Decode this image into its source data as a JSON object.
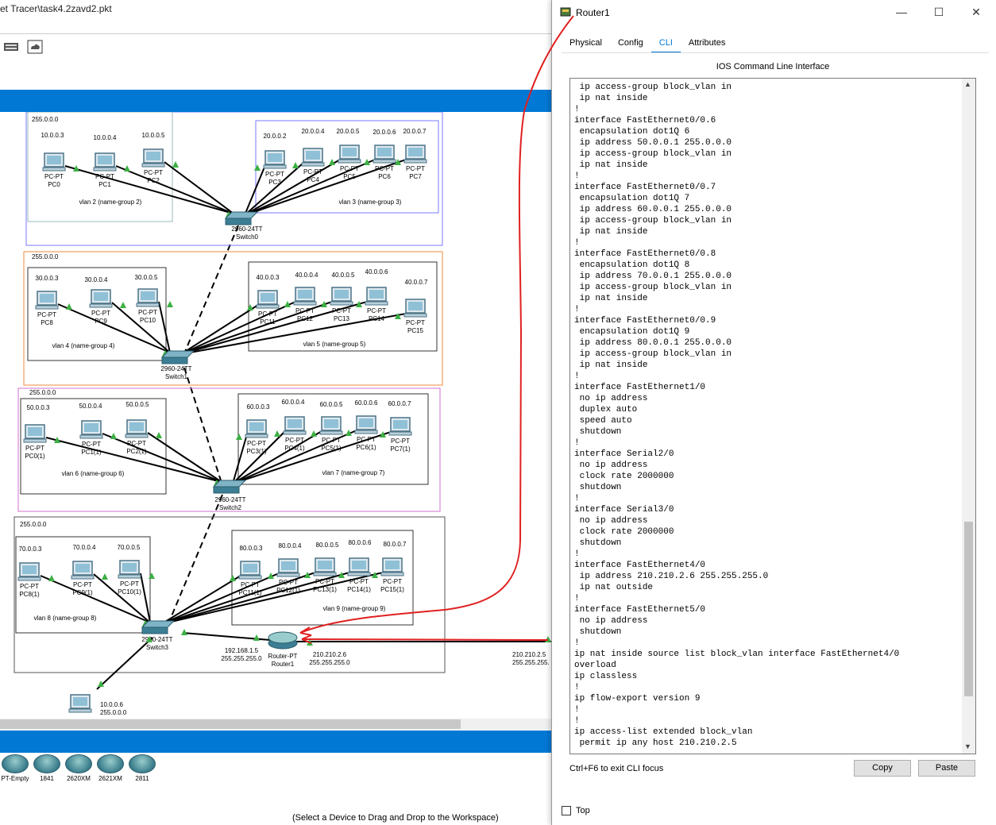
{
  "app": {
    "title": "et Tracer\\task4.2zavd2.pkt",
    "status_hint": "(Select a Device to Drag and Drop to the Workspace)"
  },
  "devices": [
    {
      "label": "PT-Empty",
      "icon": "router-icon"
    },
    {
      "label": "1841",
      "icon": "router-icon"
    },
    {
      "label": "2620XM",
      "icon": "router-icon"
    },
    {
      "label": "2621XM",
      "icon": "router-icon"
    },
    {
      "label": "2811",
      "icon": "router-icon"
    }
  ],
  "topology": {
    "group1": {
      "mask": "255.0.0.0",
      "left": {
        "label": "vlan 2 (name-group 2)",
        "pcs": [
          {
            "ip": "10.0.0.3",
            "name": "PC-PT\nPC0"
          },
          {
            "ip": "10.0.0.4",
            "name": "PC-PT\nPC1"
          },
          {
            "ip": "10.0.0.5",
            "name": "PC-PT\nPC2"
          }
        ]
      },
      "right": {
        "label": "vlan 3 (name-group 3)",
        "pcs": [
          {
            "ip": "20.0.0.2",
            "name": "PC-PT\nPC3"
          },
          {
            "ip": "20.0.0.4",
            "name": "PC-PT\nPC4"
          },
          {
            "ip": "20.0.0.5",
            "name": "PC-PT\nPC5"
          },
          {
            "ip": "20.0.0.6",
            "name": "PC-PT\nPC6"
          },
          {
            "ip": "20.0.0.7",
            "name": "PC-PT\nPC7"
          }
        ]
      },
      "switch": "2960-24TT\nSwitch0"
    },
    "group2": {
      "mask": "255.0.0.0",
      "left": {
        "label": "vlan 4 (name-group 4)",
        "pcs": [
          {
            "ip": "30.0.0.3",
            "name": "PC-PT\nPC8"
          },
          {
            "ip": "30.0.0.4",
            "name": "PC-PT\nPC9"
          },
          {
            "ip": "30.0.0.5",
            "name": "PC-PT\nPC10"
          }
        ]
      },
      "right": {
        "label": "vlan 5 (name-group 5)",
        "pcs": [
          {
            "ip": "40.0.0.3",
            "name": "PC-PT\nPC11"
          },
          {
            "ip": "40.0.0.4",
            "name": "PC-PT\nPC12"
          },
          {
            "ip": "40.0.0.5",
            "name": "PC-PT\nPC13"
          },
          {
            "ip": "40.0.0.6",
            "name": "PC-PT\nPC14"
          },
          {
            "ip": "40.0.0.7",
            "name": "PC-PT\nPC15"
          }
        ]
      },
      "switch": "2960-24TT\nSwitch1"
    },
    "group3": {
      "mask": "255.0.0.0",
      "left": {
        "label": "vlan 6 (name-group 6)",
        "pcs": [
          {
            "ip": "50.0.0.3",
            "name": "PC-PT\nPC0(1)"
          },
          {
            "ip": "50.0.0.4",
            "name": "PC-PT\nPC1(1)"
          },
          {
            "ip": "50.0.0.5",
            "name": "PC-PT\nPC2(1)"
          }
        ]
      },
      "right": {
        "label": "vlan 7 (name-group 7)",
        "pcs": [
          {
            "ip": "60.0.0.3",
            "name": "PC-PT\nPC3(1)"
          },
          {
            "ip": "60.0.0.4",
            "name": "PC-PT\nPC4(1)"
          },
          {
            "ip": "60.0.0.5",
            "name": "PC-PT\nPC5(1)"
          },
          {
            "ip": "60.0.0.6",
            "name": "PC-PT\nPC6(1)"
          },
          {
            "ip": "60.0.0.7",
            "name": "PC-PT\nPC7(1)"
          }
        ]
      },
      "switch": "2960-24TT\nSwitch2"
    },
    "group4": {
      "mask": "255.0.0.0",
      "left": {
        "label": "vlan 8 (name-group 8)",
        "pcs": [
          {
            "ip": "70.0.0.3",
            "name": "PC-PT\nPC8(1)"
          },
          {
            "ip": "70.0.0.4",
            "name": "PC-PT\nPC9(1)"
          },
          {
            "ip": "70.0.0.5",
            "name": "PC-PT\nPC10(1)"
          }
        ]
      },
      "right": {
        "label": "vlan 9 (name-group 9)",
        "pcs": [
          {
            "ip": "80.0.0.3",
            "name": "PC-PT\nPC11(1)"
          },
          {
            "ip": "80.0.0.4",
            "name": "PC-PT\nPC12(1)"
          },
          {
            "ip": "80.0.0.5",
            "name": "PC-PT\nPC13(1)"
          },
          {
            "ip": "80.0.0.6",
            "name": "PC-PT\nPC14(1)"
          },
          {
            "ip": "80.0.0.7",
            "name": "PC-PT\nPC15(1)"
          }
        ]
      },
      "switch": "2960-24TT\nSwitch3"
    },
    "router": {
      "name": "Router-PT\nRouter1",
      "ip_in": "192.168.1.5\n255.255.255.0",
      "ip_out": "210.210.2.6\n255.255.255.0"
    },
    "remote": {
      "ip": "210.210.2.5\n255.255.255."
    },
    "server_pc": {
      "ip": "10.0.0.6\n255.0.0.0"
    }
  },
  "window": {
    "title": "Router1",
    "tabs": [
      "Physical",
      "Config",
      "CLI",
      "Attributes"
    ],
    "active_tab": "CLI",
    "cli_header": "IOS Command Line Interface",
    "cli_lines": " ip access-group block_vlan in\n ip nat inside\n!\ninterface FastEthernet0/0.6\n encapsulation dot1Q 6\n ip address 50.0.0.1 255.0.0.0\n ip access-group block_vlan in\n ip nat inside\n!\ninterface FastEthernet0/0.7\n encapsulation dot1Q 7\n ip address 60.0.0.1 255.0.0.0\n ip access-group block_vlan in\n ip nat inside\n!\ninterface FastEthernet0/0.8\n encapsulation dot1Q 8\n ip address 70.0.0.1 255.0.0.0\n ip access-group block_vlan in\n ip nat inside\n!\ninterface FastEthernet0/0.9\n encapsulation dot1Q 9\n ip address 80.0.0.1 255.0.0.0\n ip access-group block_vlan in\n ip nat inside\n!\ninterface FastEthernet1/0\n no ip address\n duplex auto\n speed auto\n shutdown\n!\ninterface Serial2/0\n no ip address\n clock rate 2000000\n shutdown\n!\ninterface Serial3/0\n no ip address\n clock rate 2000000\n shutdown\n!\ninterface FastEthernet4/0\n ip address 210.210.2.6 255.255.255.0\n ip nat outside\n!\ninterface FastEthernet5/0\n no ip address\n shutdown\n!\nip nat inside source list block_vlan interface FastEthernet4/0\noverload\nip classless\n!\nip flow-export version 9\n!\n!\nip access-list extended block_vlan\n permit ip any host 210.210.2.5",
    "hint": "Ctrl+F6 to exit CLI focus",
    "copy_label": "Copy",
    "paste_label": "Paste",
    "top_label": "Top"
  },
  "colors": {
    "accent": "#0078d4",
    "annotation": "#e02020",
    "link_tip": "#3cb043"
  }
}
